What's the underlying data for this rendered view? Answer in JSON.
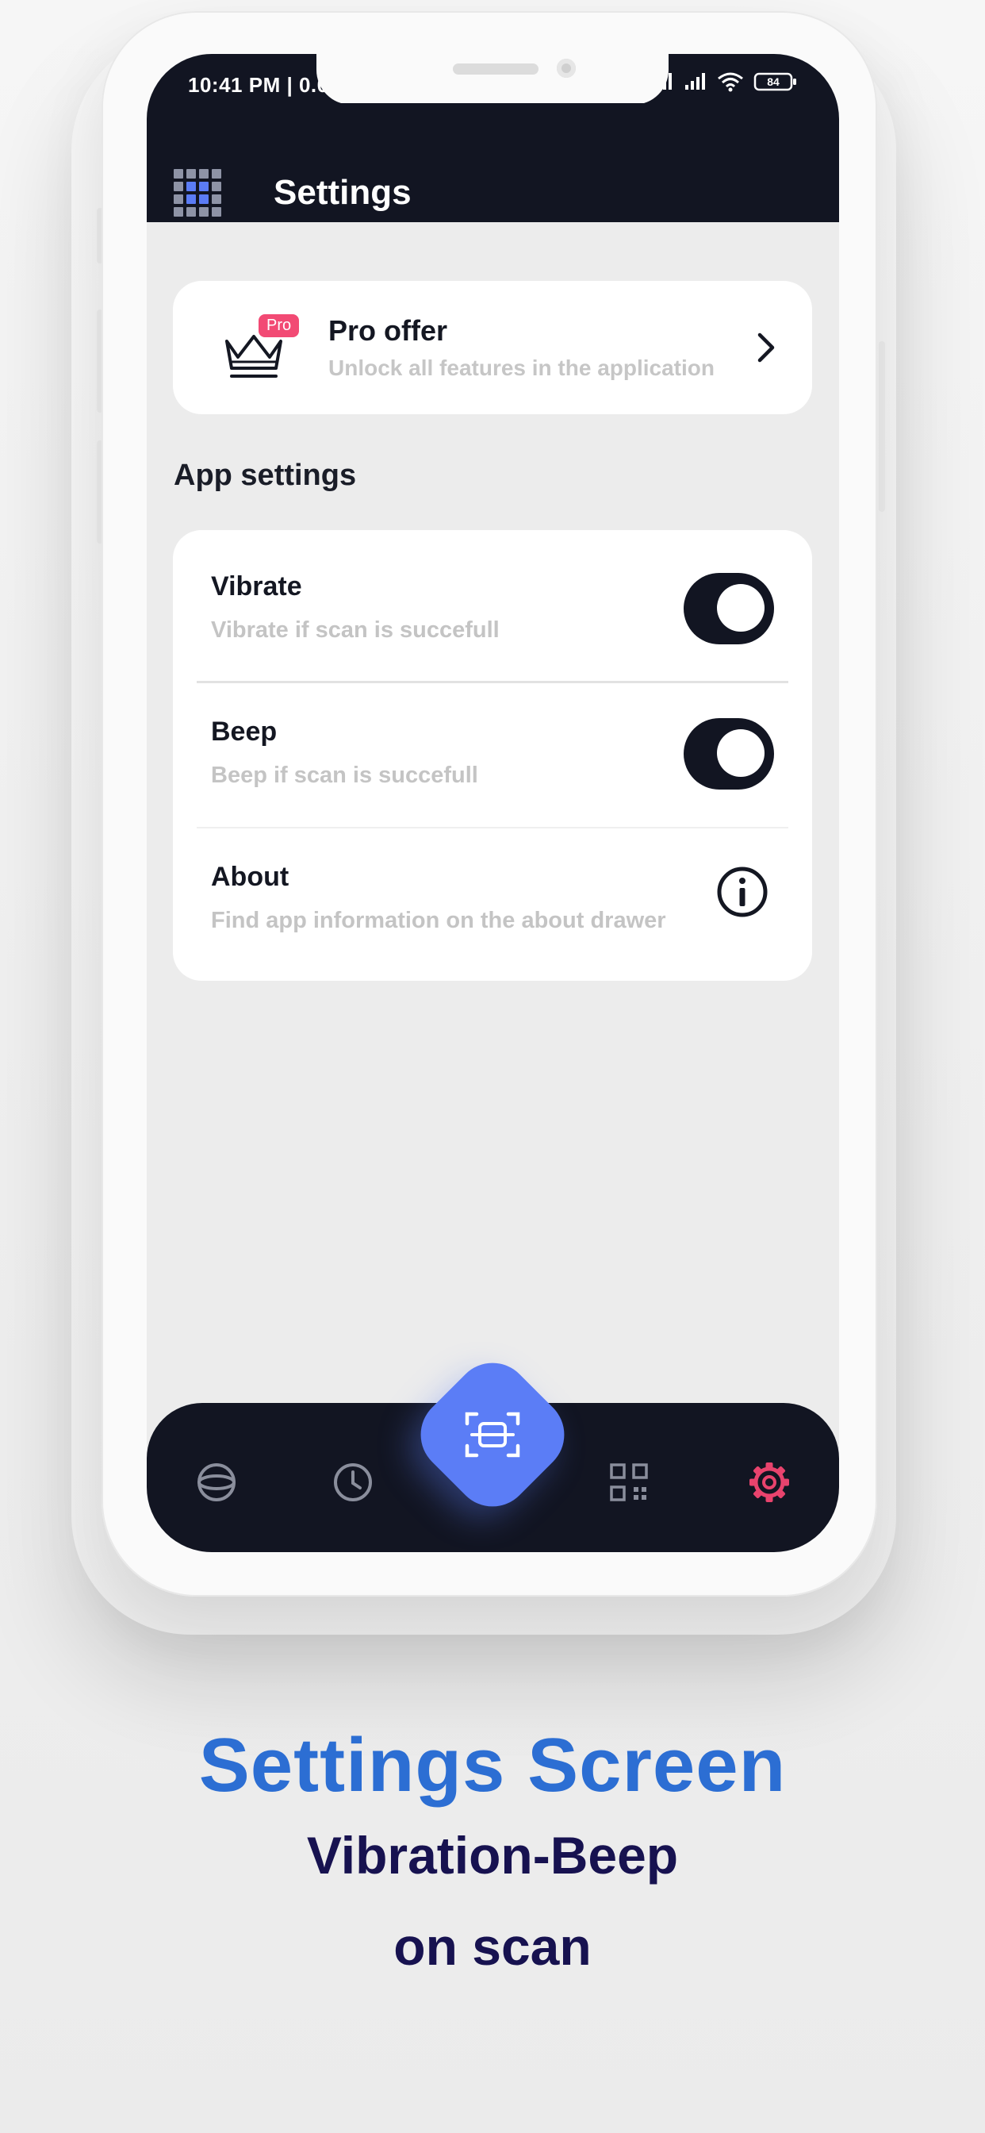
{
  "status_bar": {
    "time": "10:41 PM | 0.0",
    "battery": "84"
  },
  "header": {
    "title": "Settings"
  },
  "pro_offer": {
    "badge": "Pro",
    "title": "Pro offer",
    "subtitle": "Unlock all features in the application"
  },
  "section": {
    "title": "App settings"
  },
  "settings": [
    {
      "title": "Vibrate",
      "subtitle": "Vibrate if scan is succefull",
      "enabled": true
    },
    {
      "title": "Beep",
      "subtitle": "Beep if scan is succefull",
      "enabled": true
    },
    {
      "title": "About",
      "subtitle": "Find app information on the about drawer"
    }
  ],
  "bottom_nav": {
    "items": [
      "explore-icon",
      "history-icon",
      "scan-icon",
      "qr-code-icon",
      "gear-icon"
    ],
    "active": "gear-icon"
  },
  "colors": {
    "dark": "#121522",
    "accent_blue": "#5b7df6",
    "pro_badge": "#f24a74",
    "active_nav": "#e8436d",
    "caption_title": "#2c6ed3",
    "caption_text": "#171250"
  },
  "caption": {
    "title": "Settings Screen",
    "line1": "Vibration-Beep",
    "line2": "on scan"
  }
}
